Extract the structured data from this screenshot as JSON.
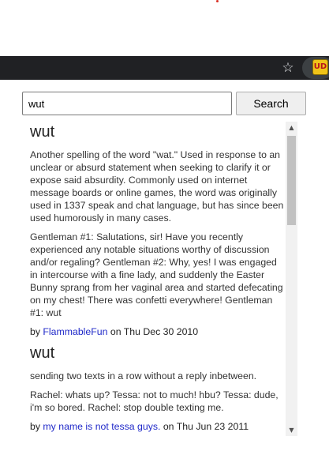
{
  "toolbar": {
    "star_icon": "star-outline-icon",
    "extension_icon": "urban-dictionary-extension-icon",
    "extension_glyph": "UD"
  },
  "search": {
    "value": "wut",
    "button_label": "Search"
  },
  "results": [
    {
      "word": "wut",
      "definition": "Another spelling of the word \"wat.\" Used in response to an unclear or absurd statement when seeking to clarify it or expose said absurdity. Commonly used on internet message boards or online games, the word was originally used in 1337 speak and chat language, but has since been used humorously in many cases.",
      "example": "Gentleman #1: Salutations, sir! Have you recently experienced any notable situations worthy of discussion and/or regaling? Gentleman #2: Why, yes! I was engaged in intercourse with a fine lady, and suddenly the Easter Bunny sprang from her vaginal area and started defecating on my chest! There was confetti everywhere! Gentleman #1: wut",
      "by_prefix": "by",
      "author": "FlammableFun",
      "date_prefix": "on",
      "date": "Thu Dec 30 2010"
    },
    {
      "word": "wut",
      "definition": "sending two texts in a row without a reply inbetween.",
      "example": "Rachel: whats up? Tessa: not to much! hbu? Tessa: dude, i'm so bored. Rachel: stop double texting me.",
      "by_prefix": "by",
      "author": "my name is not tessa guys.",
      "date_prefix": "on",
      "date": "Thu Jun 23 2011"
    }
  ],
  "scrollbar": {
    "up_icon": "scroll-up-arrow-icon",
    "down_icon": "scroll-down-arrow-icon",
    "up_glyph": "▲",
    "down_glyph": "▼"
  },
  "colors": {
    "toolbar_bg": "#202124",
    "link": "#2029c9",
    "extension_bg": "#f0c419"
  }
}
